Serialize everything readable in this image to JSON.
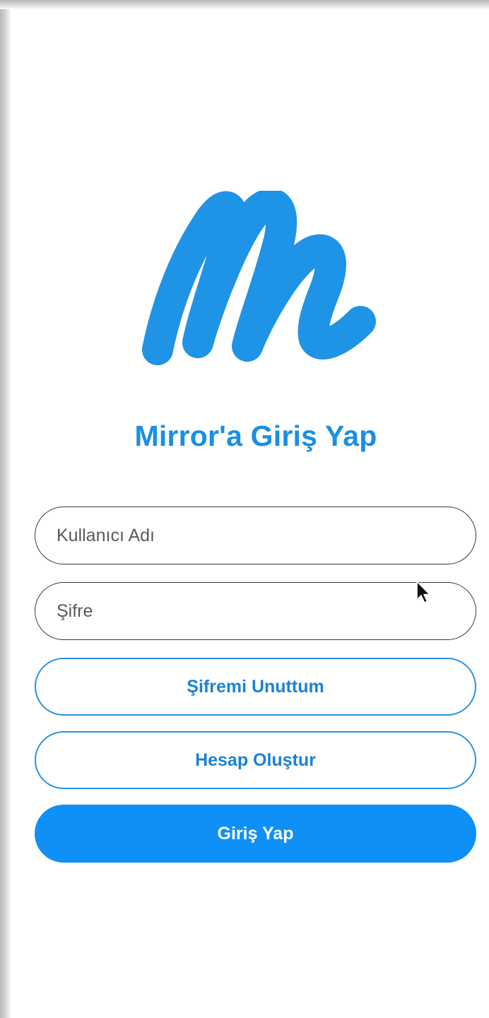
{
  "app": {
    "brand_color": "#1a8fe3",
    "logo_icon": "mirror-m-logo-icon"
  },
  "login": {
    "title": "Mirror'a Giriş Yap",
    "username_placeholder": "Kullanıcı Adı",
    "password_placeholder": "Şifre",
    "forgot_password_label": "Şifremi Unuttum",
    "create_account_label": "Hesap Oluştur",
    "login_label": "Giriş Yap"
  },
  "colors": {
    "primary_button": "#0f90f7",
    "outline_button_border": "#2a93e4",
    "field_border": "#3a3a3a"
  }
}
